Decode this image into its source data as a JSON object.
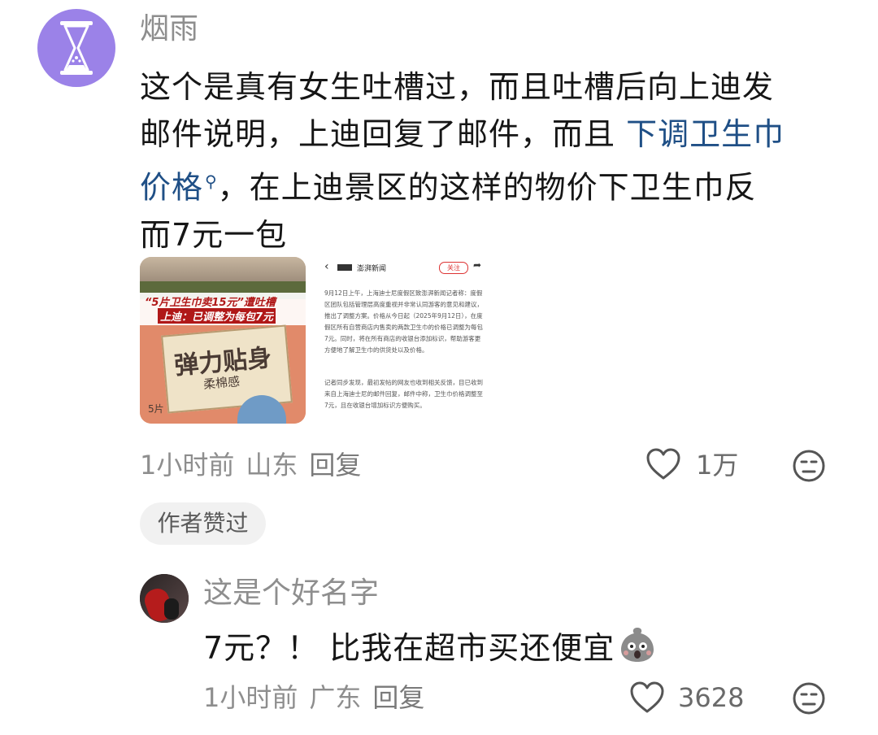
{
  "comment1": {
    "username": "烟雨",
    "text_line1": "这个是真有女生吐槽过，而且吐槽后向上迪发",
    "text_line2_prefix": "邮件说明，上迪回复了邮件，而且 ",
    "text_line2_link": "下调卫生巾",
    "text_line3_link": "价格",
    "text_line3_suffix": "，在上迪景区的这样的物价下卫生巾反",
    "text_line4": "而7元一包",
    "image1": {
      "headline_line1": "“5片卫生巾卖15元”遭吐槽",
      "headline_line2": "上迪：已调整为每包7元",
      "product_title": "弹力贴身",
      "product_sub": "柔棉感",
      "product_count": "5片"
    },
    "image2": {
      "back_icon": "‹",
      "source_name": "澎湃新闻",
      "follow_label": "关注",
      "para1": "9月12日上午，上海迪士尼度假区致澎湃新闻记者称：度假区团队包括管理层高度重视并非常认同游客的意见和建议，推出了调整方案。价格从今日起（2025年9月12日），在度假区所有自营商店内售卖的两款卫生巾的价格已调整为每包7元。同时，将在所有商店的收银台添加标识，帮助游客更方便地了解卫生巾的供货处以及价格。",
      "para2": "记者同步发现，最初发帖的网友也收到相关反馈，目已收到来自上海迪士尼的邮件回复，邮件中称，卫生巾价格调整至7元，且在收银台增加标识方便购买。"
    },
    "time": "1小时前",
    "location": "山东",
    "reply_label": "回复",
    "like_count": "1万",
    "badge": "作者赞过"
  },
  "comment2": {
    "username": "这是个好名字",
    "text": "7元？！ 比我在超市买还便宜",
    "time": "1小时前",
    "location": "广东",
    "reply_label": "回复",
    "like_count": "3628"
  },
  "colors": {
    "link": "#1f4f86",
    "meta_gray": "#8e8e8e",
    "avatar_purple": "#9b82e8",
    "headline_red": "#c81e1e"
  }
}
